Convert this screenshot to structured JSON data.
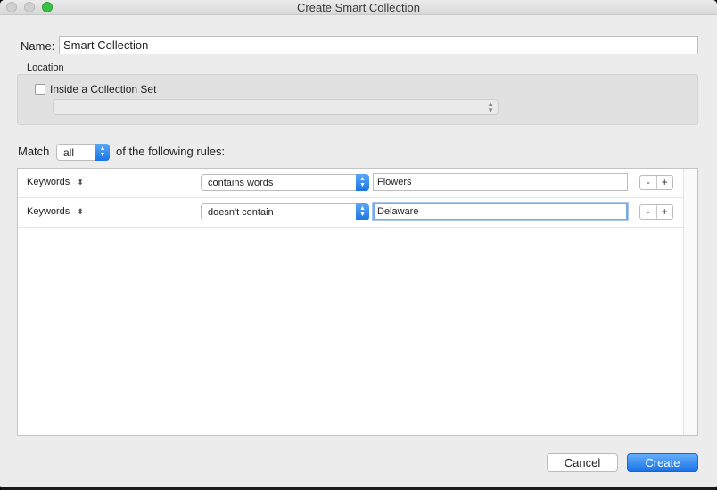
{
  "window": {
    "title": "Create Smart Collection"
  },
  "name": {
    "label": "Name:",
    "value": "Smart Collection"
  },
  "location": {
    "label": "Location",
    "checkbox_label": "Inside a Collection Set",
    "checked": false,
    "set_value": ""
  },
  "match": {
    "prefix": "Match",
    "selected": "all",
    "suffix": "of the following rules:"
  },
  "rules": [
    {
      "field": "Keywords",
      "operator": "contains words",
      "value": "Flowers",
      "minus": "-",
      "plus": "+"
    },
    {
      "field": "Keywords",
      "operator": "doesn't contain",
      "value": "Delaware",
      "minus": "-",
      "plus": "+"
    }
  ],
  "buttons": {
    "cancel": "Cancel",
    "create": "Create"
  },
  "colors": {
    "accent": "#1a74e4",
    "zoom_button": "#3bc047"
  }
}
